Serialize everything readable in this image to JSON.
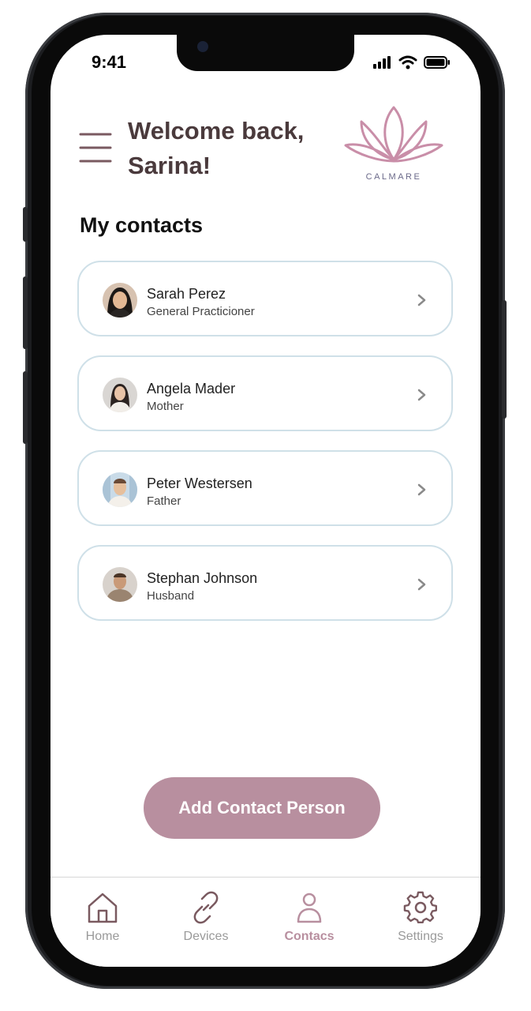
{
  "status_bar": {
    "time": "9:41"
  },
  "header": {
    "welcome_line1": "Welcome back,",
    "welcome_line2": "Sarina!",
    "logo_text": "CALMARE"
  },
  "section_title": "My contacts",
  "contacts": [
    {
      "name": "Sarah Perez",
      "role": "General Practicioner"
    },
    {
      "name": "Angela Mader",
      "role": "Mother"
    },
    {
      "name": "Peter Westersen",
      "role": "Father"
    },
    {
      "name": "Stephan Johnson",
      "role": "Husband"
    }
  ],
  "add_button": "Add Contact Person",
  "tabs": [
    {
      "label": "Home",
      "icon": "home-icon"
    },
    {
      "label": "Devices",
      "icon": "link-icon"
    },
    {
      "label": "Contacs",
      "icon": "person-icon",
      "active": true
    },
    {
      "label": "Settings",
      "icon": "gear-icon"
    }
  ],
  "colors": {
    "accent": "#b88f9f",
    "heading": "#4a3a3c",
    "card_border": "#cfe0e8"
  }
}
